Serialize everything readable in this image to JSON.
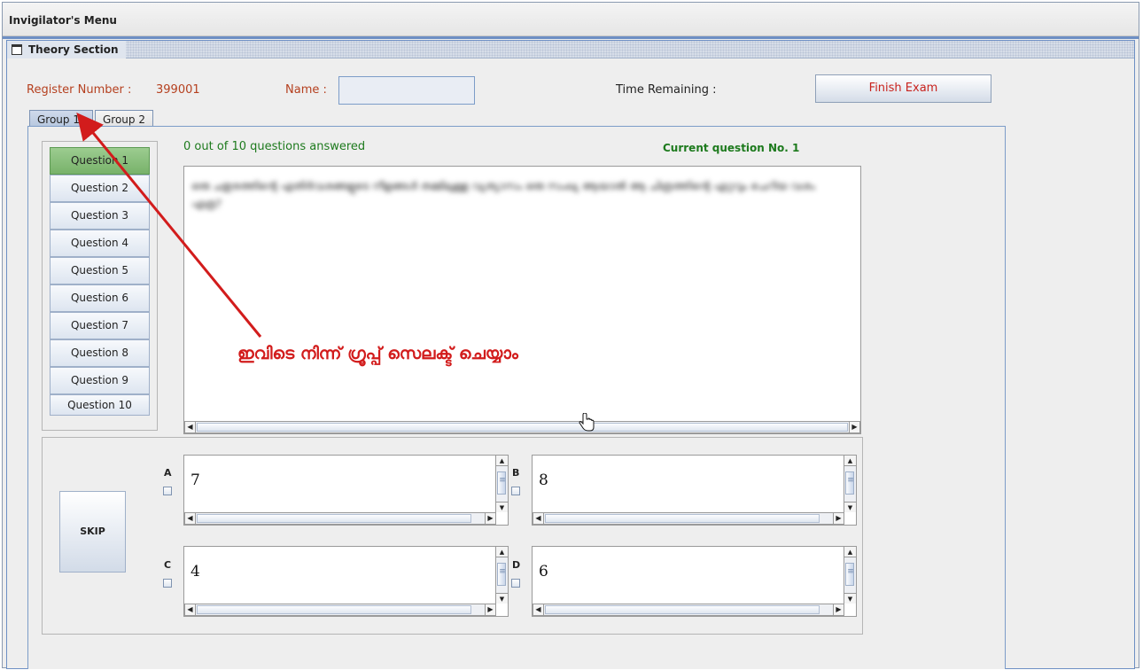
{
  "window": {
    "title": "Invigilator's Menu"
  },
  "frame": {
    "title": "Theory Section"
  },
  "header": {
    "register_label": "Register Number :",
    "register_value": "399001",
    "name_label": "Name :",
    "name_value": "",
    "time_label": "Time Remaining :",
    "finish_label": "Finish Exam"
  },
  "tabs": [
    {
      "label": "Group 1",
      "selected": true
    },
    {
      "label": "Group 2",
      "selected": false
    }
  ],
  "questions": {
    "answered_text": "0 out of 10 questions answered",
    "current_text": "Current question No. 1",
    "items": [
      "Question 1",
      "Question 2",
      "Question 3",
      "Question 4",
      "Question 5",
      "Question 6",
      "Question 7",
      "Question 8",
      "Question 9",
      "Question 10"
    ],
    "active_index": 0,
    "question_text": "ഒരു ചതുരത്തിന്റെ എതിർവശങ്ങളുടെ നീളങ്ങൾ തമ്മിലുള്ള വ്യത്യാസം ഒരു സംഖ്യ ആയാൽ ആ ചിത്രത്തിന്റെ ഏറ്റവും ചെറിയ വശം എത്ര?"
  },
  "annotation": {
    "text": "ഇവിടെ നിന്ന് ഗ്രൂപ്പ് സെലക്ട് ചെയ്യാം",
    "color": "#d21c1c"
  },
  "options": {
    "skip_label": "SKIP",
    "items": [
      {
        "letter": "A",
        "value": "7"
      },
      {
        "letter": "B",
        "value": "8"
      },
      {
        "letter": "C",
        "value": "4"
      },
      {
        "letter": "D",
        "value": "6"
      }
    ]
  },
  "colors": {
    "accent": "#6d8fc4",
    "label_red": "#b5401f",
    "status_green": "#1d7a1d",
    "finish_red": "#c8231e",
    "active_question": "#78b26a"
  }
}
